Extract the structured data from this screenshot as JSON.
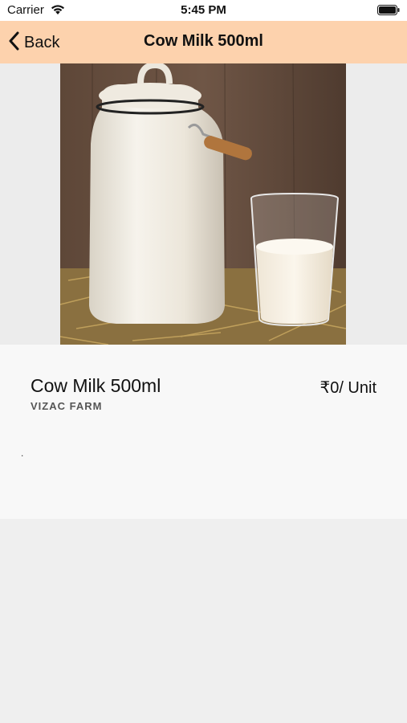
{
  "status_bar": {
    "carrier": "Carrier",
    "time": "5:45 PM",
    "wifi_icon": "wifi-icon",
    "battery_icon": "battery-icon"
  },
  "nav": {
    "back_label": "Back",
    "back_icon": "chevron-left-icon",
    "title": "Cow Milk 500ml",
    "background": "#fdd2ad"
  },
  "product": {
    "image": "product-photo-milk-can-and-glass",
    "name": "Cow Milk 500ml",
    "farm": "VIZAC FARM",
    "price": "₹0/ Unit",
    "description": "."
  }
}
